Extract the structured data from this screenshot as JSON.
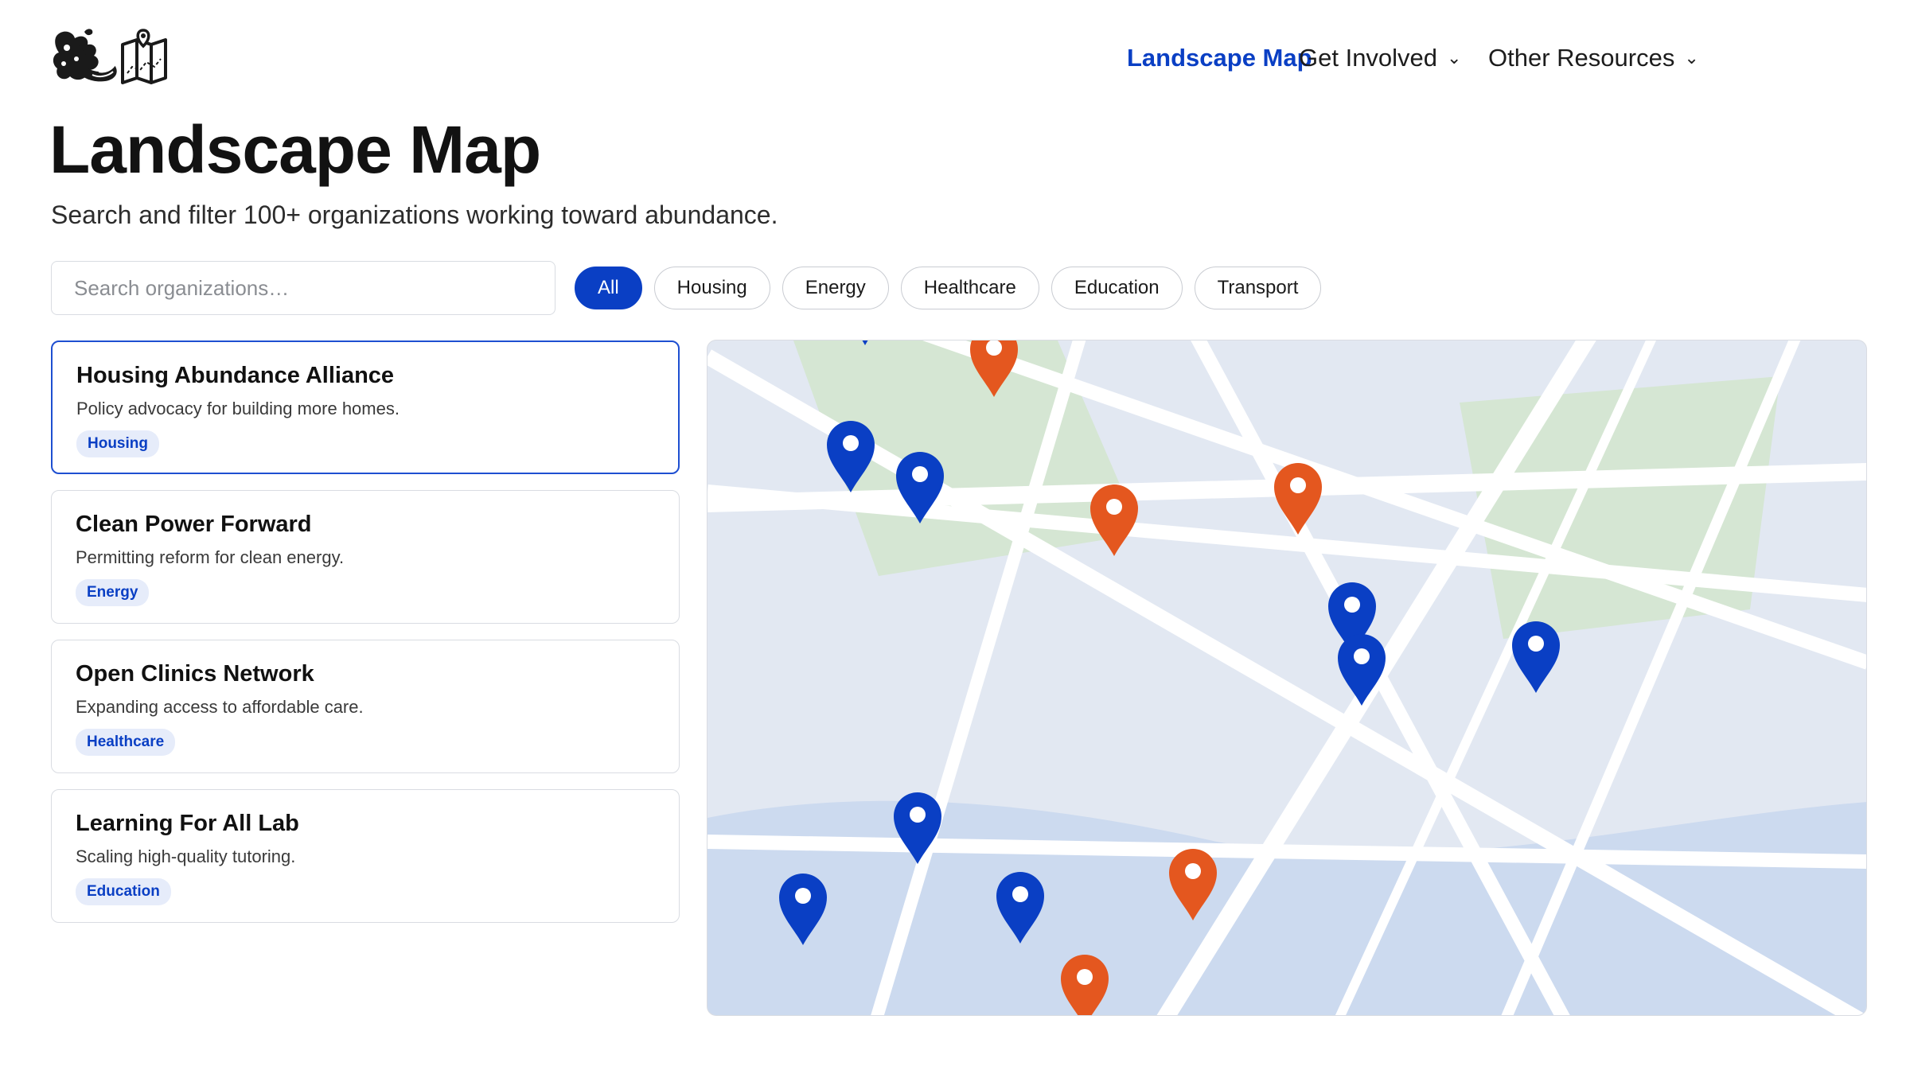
{
  "nav": {
    "items": [
      {
        "label": "Landscape Map",
        "active": true,
        "dropdown": false
      },
      {
        "label": "Get Involved",
        "active": false,
        "dropdown": true
      },
      {
        "label": "Other Resources",
        "active": false,
        "dropdown": true
      }
    ]
  },
  "page": {
    "title": "Landscape Map",
    "subtitle": "Search and filter 100+ organizations working toward abundance."
  },
  "search": {
    "placeholder": "Search organizations…",
    "value": ""
  },
  "filters": {
    "options": [
      "All",
      "Housing",
      "Energy",
      "Healthcare",
      "Education",
      "Transport"
    ],
    "selected": "All"
  },
  "organizations": [
    {
      "name": "Housing Abundance Alliance",
      "description": "Policy advocacy for building more homes.",
      "tag": "Housing",
      "selected": true
    },
    {
      "name": "Clean Power Forward",
      "description": "Permitting reform for clean energy.",
      "tag": "Energy",
      "selected": false
    },
    {
      "name": "Open Clinics Network",
      "description": "Expanding access to affordable care.",
      "tag": "Healthcare",
      "selected": false
    },
    {
      "name": "Learning For All Lab",
      "description": "Scaling high-quality tutoring.",
      "tag": "Education",
      "selected": false
    }
  ],
  "map": {
    "colors": {
      "land": "#e2e8f2",
      "water": "#ccdaef",
      "park": "#d5e6d3",
      "road": "#ffffff",
      "pin_blue": "#0a3fc4",
      "pin_orange": "#e4571f"
    }
  },
  "icons": {
    "logo": "cornucopia-and-map-logo",
    "dropdown": "chevron-down-icon",
    "map_pin": "map-pin-icon"
  }
}
